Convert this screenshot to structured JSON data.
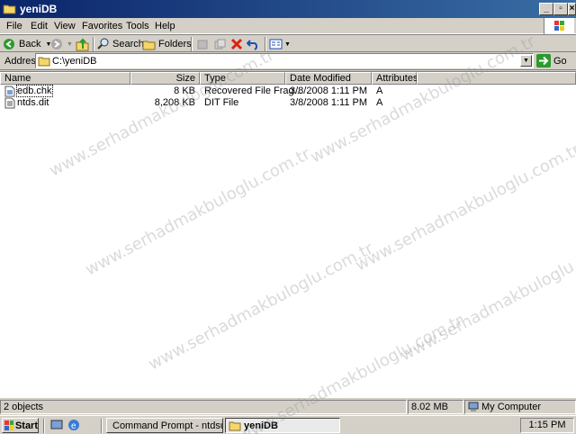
{
  "window": {
    "title": "yeniDB",
    "buttons": [
      "minimize",
      "restore",
      "close"
    ]
  },
  "menu": [
    "File",
    "Edit",
    "View",
    "Favorites",
    "Tools",
    "Help"
  ],
  "toolbar": {
    "back": "Back",
    "search": "Search",
    "folders": "Folders"
  },
  "address": {
    "label": "Address",
    "value": "C:\\yeniDB",
    "go": "Go"
  },
  "columns": [
    "Name",
    "Size",
    "Type",
    "Date Modified",
    "Attributes"
  ],
  "files": [
    {
      "name": "edb.chk",
      "size": "8 KB",
      "type": "Recovered File Frag...",
      "date": "3/8/2008 1:11 PM",
      "attr": "A"
    },
    {
      "name": "ntds.dit",
      "size": "8,208 KB",
      "type": "DIT File",
      "date": "3/8/2008 1:11 PM",
      "attr": "A"
    }
  ],
  "status": {
    "objects": "2 objects",
    "size": "8.02 MB",
    "location": "My Computer"
  },
  "taskbar": {
    "start": "Start",
    "tasks": [
      "Command Prompt - ntdsutil",
      "yeniDB"
    ],
    "clock": "1:15 PM"
  },
  "watermark": "www.serhadmakbuloglu.com.tr",
  "colors": {
    "titlebar": "#0a246a",
    "face": "#d4d0c8"
  }
}
